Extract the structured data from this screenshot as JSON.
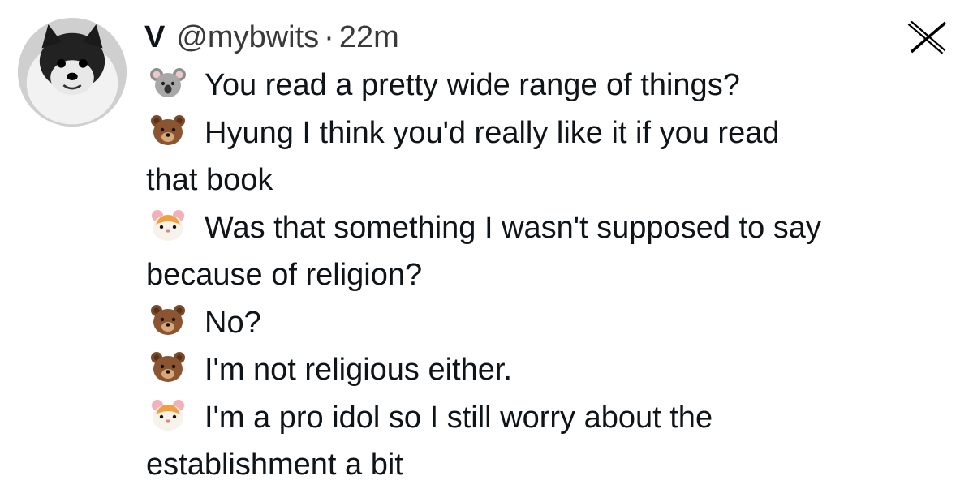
{
  "tweet": {
    "author_name": "V",
    "handle": "@mybwits",
    "separator": "·",
    "time": "22m",
    "platform_icon": "x-logo-icon",
    "avatar_icon": "dog-avatar",
    "lines": [
      {
        "icon": "koala-icon",
        "text": "You read a pretty wide range of things?"
      },
      {
        "icon": "bear-icon",
        "text": "Hyung I think you'd really like it if you read"
      },
      {
        "icon": "",
        "text": "that book"
      },
      {
        "icon": "hamster-icon",
        "text": "Was that something I wasn't supposed to say"
      },
      {
        "icon": "",
        "text": "because of religion?"
      },
      {
        "icon": "bear-icon",
        "text": "No?"
      },
      {
        "icon": "bear-icon",
        "text": "I'm not religious either."
      },
      {
        "icon": "hamster-icon",
        "text": "I'm a pro idol so I still worry about the"
      },
      {
        "icon": "",
        "text": "establishment a bit"
      }
    ]
  },
  "colors": {
    "text": "#0f1419",
    "secondary": "#3a3a3a",
    "background": "#ffffff"
  }
}
